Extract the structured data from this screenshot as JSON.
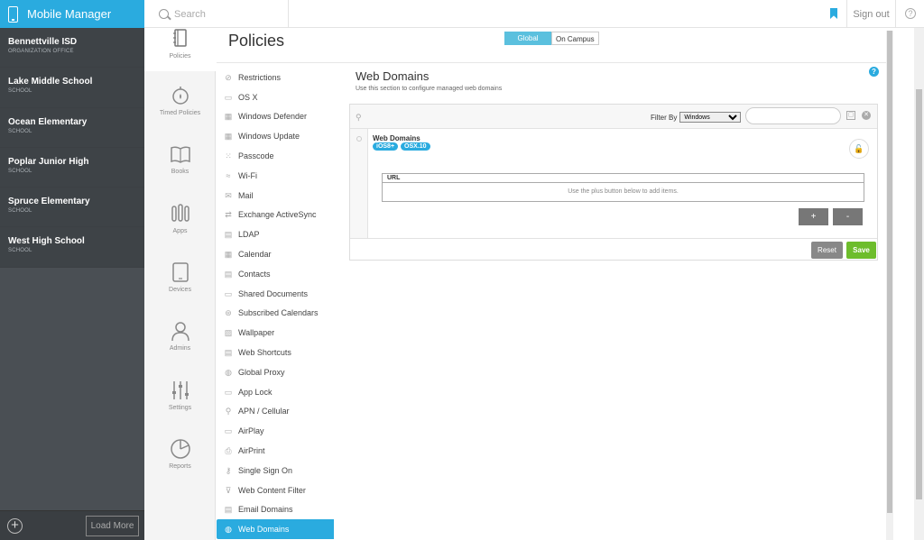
{
  "app": {
    "title": "Mobile Manager"
  },
  "search": {
    "placeholder": "Search"
  },
  "header": {
    "signout_label": "Sign out",
    "help_glyph": "?"
  },
  "sidebar": {
    "orgs": [
      {
        "name": "Bennettville ISD",
        "type": "ORGANIZATION OFFICE"
      },
      {
        "name": "Lake Middle School",
        "type": "SCHOOL"
      },
      {
        "name": "Ocean Elementary",
        "type": "SCHOOL"
      },
      {
        "name": "Poplar Junior High",
        "type": "SCHOOL"
      },
      {
        "name": "Spruce Elementary",
        "type": "SCHOOL"
      },
      {
        "name": "West High School",
        "type": "SCHOOL"
      }
    ],
    "load_more_label": "Load More",
    "add_glyph": "+"
  },
  "rail": [
    {
      "label": "Policies",
      "icon": "notebook-icon",
      "active": true
    },
    {
      "label": "Timed Policies",
      "icon": "timer-icon"
    },
    {
      "label": "Books",
      "icon": "book-icon"
    },
    {
      "label": "Apps",
      "icon": "tools-icon"
    },
    {
      "label": "Devices",
      "icon": "tablet-icon"
    },
    {
      "label": "Admins",
      "icon": "person-icon"
    },
    {
      "label": "Settings",
      "icon": "sliders-icon"
    },
    {
      "label": "Reports",
      "icon": "pie-chart-icon"
    }
  ],
  "main": {
    "title": "Policies",
    "scope_global": "Global",
    "scope_campus": "On Campus"
  },
  "settings_list": [
    {
      "label": "Restrictions",
      "glyph": "⊘"
    },
    {
      "label": "OS X",
      "glyph": "▭"
    },
    {
      "label": "Windows Defender",
      "glyph": "▦"
    },
    {
      "label": "Windows Update",
      "glyph": "▦"
    },
    {
      "label": "Passcode",
      "glyph": "⁙"
    },
    {
      "label": "Wi-Fi",
      "glyph": "≈"
    },
    {
      "label": "Mail",
      "glyph": "✉"
    },
    {
      "label": "Exchange ActiveSync",
      "glyph": "⇄"
    },
    {
      "label": "LDAP",
      "glyph": "▤"
    },
    {
      "label": "Calendar",
      "glyph": "▦"
    },
    {
      "label": "Contacts",
      "glyph": "▤"
    },
    {
      "label": "Shared Documents",
      "glyph": "▭"
    },
    {
      "label": "Subscribed Calendars",
      "glyph": "⊛"
    },
    {
      "label": "Wallpaper",
      "glyph": "▨"
    },
    {
      "label": "Web Shortcuts",
      "glyph": "▤"
    },
    {
      "label": "Global Proxy",
      "glyph": "◍"
    },
    {
      "label": "App Lock",
      "glyph": "▭"
    },
    {
      "label": "APN / Cellular",
      "glyph": "⚲"
    },
    {
      "label": "AirPlay",
      "glyph": "▭"
    },
    {
      "label": "AirPrint",
      "glyph": "⎙"
    },
    {
      "label": "Single Sign On",
      "glyph": "⚷"
    },
    {
      "label": "Web Content Filter",
      "glyph": "⊽"
    },
    {
      "label": "Email Domains",
      "glyph": "▤"
    },
    {
      "label": "Web Domains",
      "glyph": "◍",
      "active": true
    }
  ],
  "panel": {
    "title": "Web Domains",
    "subtitle": "Use this section to configure managed web domains",
    "filter_label": "Filter By",
    "filter_options": [
      "Windows"
    ],
    "filter_value": "Windows",
    "item_label": "Web Domains",
    "chips": [
      "iOS8+",
      "OSX.10"
    ],
    "table_header": "URL",
    "table_empty": "Use the plus button below to add items.",
    "plus_label": "+",
    "minus_label": "-",
    "reset_label": "Reset",
    "save_label": "Save",
    "help_glyph": "?",
    "lock_glyph": "🔓",
    "hierarchy_glyph": "⚲",
    "collapse_glyph": "▢",
    "clear_glyph": "✕"
  },
  "colors": {
    "accent": "#2aabdf",
    "sidebar_bg": "#4a4f54",
    "save_green": "#6dbd2c",
    "button_gray": "#777777"
  }
}
